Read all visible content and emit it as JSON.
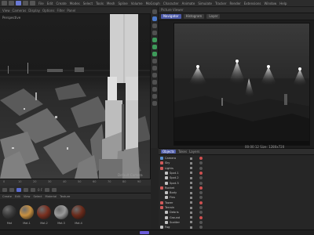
{
  "menubar": {
    "labels": [
      "File",
      "Edit",
      "Create",
      "Modes",
      "Select",
      "Tools",
      "Mesh",
      "Spline",
      "Volume",
      "MoGraph",
      "Character",
      "Animate",
      "Simulate",
      "Tracker",
      "Render",
      "Extensions",
      "Window",
      "Help"
    ]
  },
  "viewport": {
    "toolbar_items": [
      "View",
      "Cameras",
      "Display",
      "Options",
      "Filter",
      "Panel"
    ],
    "caption": "Perspective",
    "camera_label": "Default Camera"
  },
  "render_panel": {
    "title": "Picture Viewer",
    "tabs": [
      "Navigator",
      "Histogram",
      "Layer"
    ],
    "active_tab": "Navigator",
    "status": "00:00:12  Size: 1280x720"
  },
  "object_manager": {
    "tabs": [
      "Objects",
      "Takes",
      "Layers"
    ],
    "active_tab": "Objects",
    "rows": [
      {
        "name": "Camera",
        "color": "#5a8fd0"
      },
      {
        "name": "Sky",
        "color": "#d05a5a"
      },
      {
        "name": "Lights",
        "color": "#d05a5a"
      },
      {
        "name": "Spot.1",
        "color": "#c0c0c0"
      },
      {
        "name": "Spot.2",
        "color": "#c0c0c0"
      },
      {
        "name": "Spot.3",
        "color": "#c0c0c0"
      },
      {
        "name": "Rocket",
        "color": "#d05a5a"
      },
      {
        "name": "Body",
        "color": "#c0c0c0"
      },
      {
        "name": "Fins",
        "color": "#c0c0c0"
      },
      {
        "name": "Tower",
        "color": "#d05a5a"
      },
      {
        "name": "Terrain",
        "color": "#d05a5a"
      },
      {
        "name": "Debris",
        "color": "#c0c0c0"
      },
      {
        "name": "Ground",
        "color": "#c0c0c0"
      },
      {
        "name": "Scatter",
        "color": "#c0c0c0"
      },
      {
        "name": "Fog",
        "color": "#c0c0c0"
      }
    ]
  },
  "timeline": {
    "ticks": [
      "0",
      "10",
      "20",
      "30",
      "40",
      "50",
      "60",
      "70",
      "80",
      "90"
    ],
    "current_frame": "0 F"
  },
  "materials": {
    "menus": [
      "Create",
      "Edit",
      "View",
      "Select",
      "Material",
      "Texture"
    ],
    "items": [
      {
        "name": "Mat",
        "color": "#3a3a3a"
      },
      {
        "name": "Mat.1",
        "color": "#c89040"
      },
      {
        "name": "Mat.2",
        "color": "#7a3020"
      },
      {
        "name": "Mat.3",
        "color": "#9a9a9a"
      },
      {
        "name": "Mat.4",
        "color": "#6a2a1a"
      }
    ]
  },
  "colors": {
    "accent": "#5a6bd0",
    "background": "#232323"
  }
}
